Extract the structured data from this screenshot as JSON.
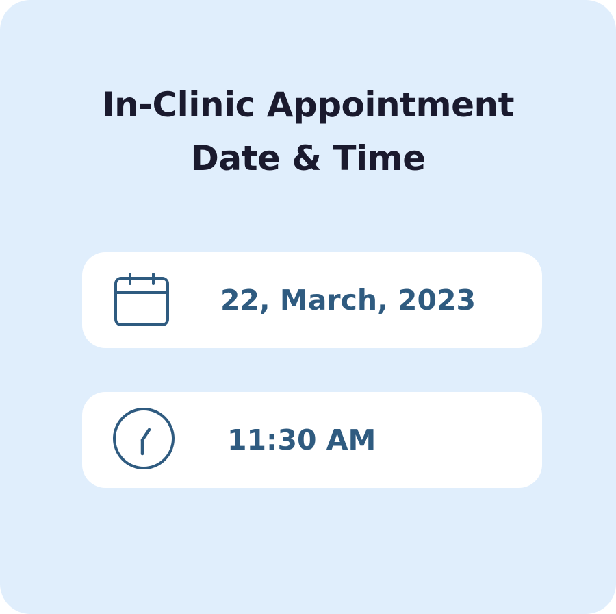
{
  "title": {
    "line1": "In-Clinic Appointment",
    "line2": "Date & Time"
  },
  "date_field": {
    "icon": "calendar-icon",
    "value": "22, March, 2023"
  },
  "time_field": {
    "icon": "clock-icon",
    "value": "11:30 AM"
  },
  "colors": {
    "card_background": "#e0eefc",
    "field_background": "#ffffff",
    "title_text": "#1a1a2e",
    "accent": "#2f5b80"
  }
}
